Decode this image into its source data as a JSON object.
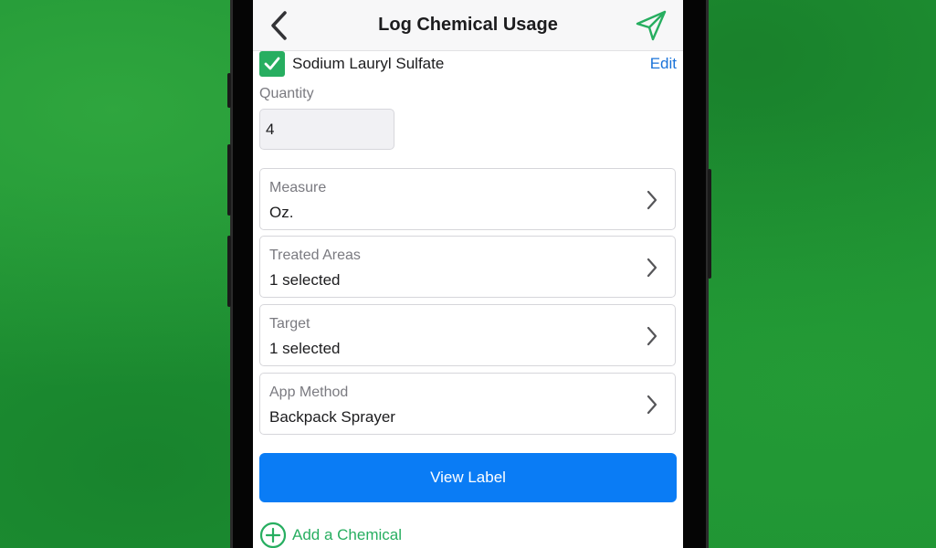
{
  "colors": {
    "background_green": "#1f9434",
    "accent_green": "#27ae60",
    "link_blue": "#1a73d9",
    "button_blue": "#0a7cf5"
  },
  "header": {
    "title": "Log Chemical Usage",
    "back_icon": "chevron-left-icon",
    "send_icon": "paper-plane-icon"
  },
  "chemical": {
    "checked": true,
    "name": "Sodium Lauryl Sulfate",
    "edit_label": "Edit"
  },
  "quantity": {
    "label": "Quantity",
    "value": "4"
  },
  "fields": [
    {
      "label": "Measure",
      "value": "Oz."
    },
    {
      "label": "Treated Areas",
      "value": "1 selected"
    },
    {
      "label": "Target",
      "value": "1 selected"
    },
    {
      "label": "App Method",
      "value": "Backpack Sprayer"
    }
  ],
  "view_label_button": "View Label",
  "add_chemical": {
    "label": "Add a Chemical",
    "icon": "plus-circle-icon"
  }
}
